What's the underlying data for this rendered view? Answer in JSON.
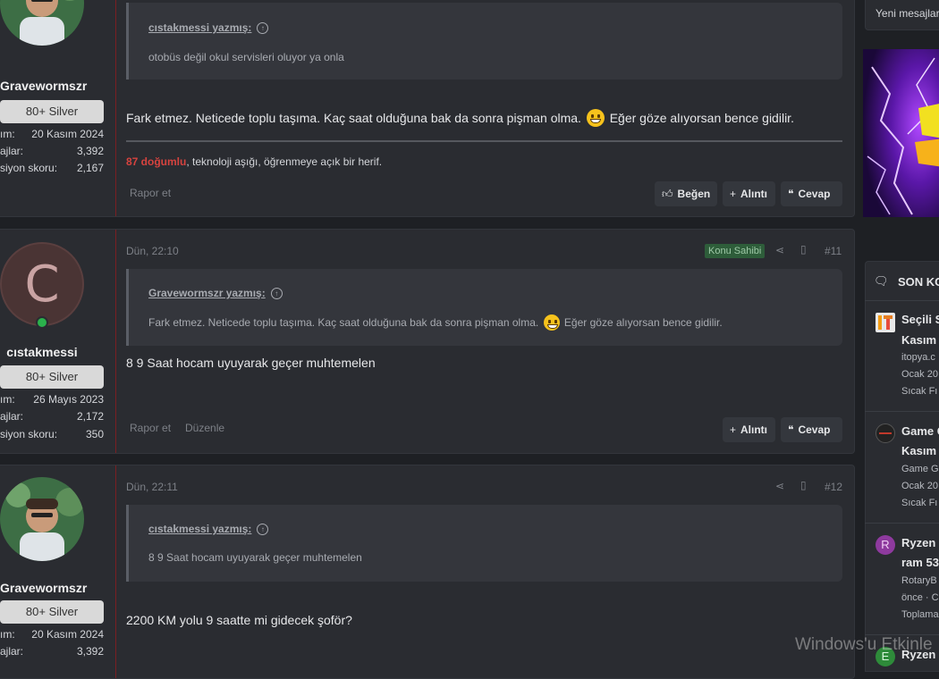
{
  "posts": [
    {
      "user": {
        "name": "Gravewormszr",
        "rank": "80+ Silver",
        "stats": [
          {
            "key": "ım:",
            "value": "20 Kasım 2024"
          },
          {
            "key": "ajlar:",
            "value": "3,392"
          },
          {
            "key": "siyon skoru:",
            "value": "2,167"
          }
        ]
      },
      "quote": {
        "author": "cıstakmessi yazmış:",
        "text": "otobüs değil okul servisleri oluyor ya onla"
      },
      "body_before": "Fark etmez. Neticede toplu taşıma. Kaç saat olduğuna bak da sonra pişman olma.",
      "body_after": "Eğer göze alıyorsan bence gidilir.",
      "signature": {
        "highlight": "87 doğumlu",
        "rest": ", teknoloji aşığı, öğrenmeye açık bir herif."
      },
      "report": "Rapor et",
      "buttons": {
        "like": "Beğen",
        "quote": "Alıntı",
        "reply": "Cevap"
      }
    },
    {
      "date": "Dün, 22:10",
      "owner_badge": "Konu Sahibi",
      "number": "#11",
      "user": {
        "initial": "C",
        "name": "cıstakmessi",
        "rank": "80+ Silver",
        "stats": [
          {
            "key": "ım:",
            "value": "26 Mayıs 2023"
          },
          {
            "key": "ajlar:",
            "value": "2,172"
          },
          {
            "key": "siyon skoru:",
            "value": "350"
          }
        ]
      },
      "quote": {
        "author": "Gravewormszr yazmış:",
        "text_before": "Fark etmez. Neticede toplu taşıma. Kaç saat olduğuna bak da sonra pişman olma.",
        "text_after": "Eğer göze alıyorsan bence gidilir."
      },
      "body": "8 9 Saat hocam uyuyarak geçer muhtemelen",
      "report": "Rapor et",
      "edit": "Düzenle",
      "buttons": {
        "quote": "Alıntı",
        "reply": "Cevap"
      }
    },
    {
      "date": "Dün, 22:11",
      "number": "#12",
      "user": {
        "name": "Gravewormszr",
        "rank": "80+ Silver",
        "stats": [
          {
            "key": "ım:",
            "value": "20 Kasım 2024"
          },
          {
            "key": "ajlar:",
            "value": "3,392"
          }
        ]
      },
      "quote": {
        "author": "cıstakmessi yazmış:",
        "text": "8 9 Saat hocam uyuyarak geçer muhtemelen"
      },
      "body": "2200 KM yolu 9 saatte mi gidecek şoför?"
    }
  ],
  "sidebar": {
    "new_messages": "Yeni mesajlar",
    "section_title": "SON KO",
    "items": [
      {
        "title1": "Seçili S",
        "title2": "Kasım",
        "sub1": "itopya.c",
        "sub2": "Ocak 20",
        "sub3": "Sıcak Fı"
      },
      {
        "title1": "Game G",
        "title2": "Kasım .",
        "sub1": "Game G",
        "sub2": "Ocak 20",
        "sub3": "Sıcak Fı"
      },
      {
        "initial": "R",
        "title1": "Ryzen",
        "title2": "ram 53",
        "sub1": "RotaryB",
        "sub2": "önce · C",
        "sub3": "Toplama"
      },
      {
        "initial": "E",
        "title1": "Ryzen"
      }
    ]
  },
  "watermark": "Windows'u Etkinle",
  "colors": {
    "accent_red": "#d6433f",
    "owner_badge": "#2e5d3a",
    "online": "#2bb24c"
  }
}
